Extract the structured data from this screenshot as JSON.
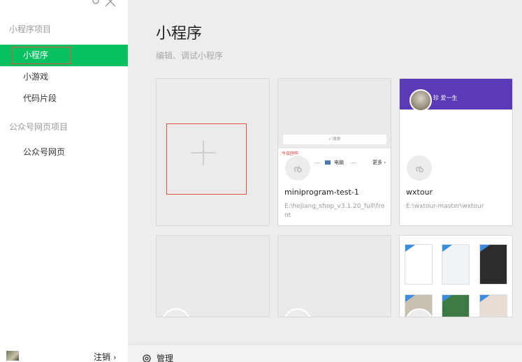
{
  "sidebar": {
    "sections": [
      {
        "label": "小程序项目"
      },
      {
        "label": "公众号网页项目"
      }
    ],
    "items": [
      {
        "label": "小程序"
      },
      {
        "label": "小游戏"
      },
      {
        "label": "代码片段"
      },
      {
        "label": "公众号网页"
      }
    ],
    "logout_label": "注销",
    "logout_chevron": "›"
  },
  "main": {
    "title": "小程序",
    "subtitle": "编辑、调试小程序",
    "projects": [
      {
        "name": "miniprogram-test-1",
        "path": "E:\\hejiang_shop_v3.1.20_full\\front",
        "preview": {
          "search": "搜索",
          "promo": "今日团购",
          "category": "电脑",
          "more": "更多 ›"
        }
      },
      {
        "name": "wxtour",
        "path": "E:\\wxtour-master\\wxtour",
        "preview": {
          "banner_text": "珍 爱一生"
        }
      }
    ]
  },
  "footer": {
    "manage_label": "管理"
  },
  "colors": {
    "accent": "#07c160",
    "selection": "#e2543b"
  },
  "icons": [
    "gear-icon",
    "close-icon",
    "plus-icon",
    "miniprogram-icon",
    "manage-gear-icon",
    "chevron-right-icon"
  ]
}
